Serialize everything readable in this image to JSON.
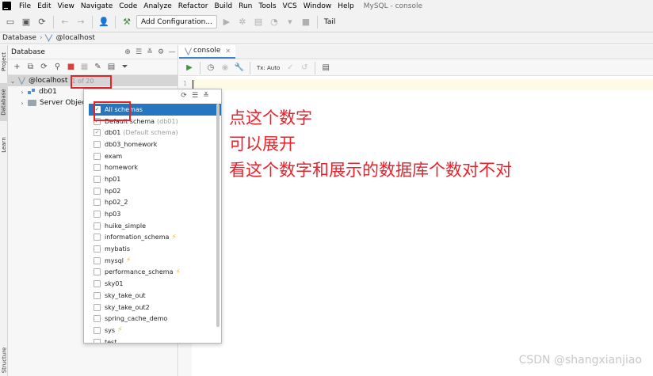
{
  "menu": {
    "items": [
      "File",
      "Edit",
      "View",
      "Navigate",
      "Code",
      "Analyze",
      "Refactor",
      "Build",
      "Run",
      "Tools",
      "VCS",
      "Window",
      "Help"
    ],
    "window_title": "MySQL - console"
  },
  "toolbar": {
    "add_config_label": "Add Configuration...",
    "tail_label": "Tail"
  },
  "breadcrumb": {
    "root": "Database",
    "host": "@localhost"
  },
  "left_stripe": {
    "project": "Project",
    "database": "Database",
    "learn": "Learn",
    "structure": "Structure"
  },
  "db_panel": {
    "title": "Database",
    "host": "@localhost",
    "count": "1 of 20",
    "db": "db01",
    "server_objects": "Server Objects"
  },
  "popup": {
    "items": [
      {
        "label": "All schemas",
        "hint": "",
        "checked": true,
        "selected": true,
        "bolt": false
      },
      {
        "label": "Default schema",
        "hint": "(db01)",
        "checked": true,
        "selected": false,
        "bolt": false
      },
      {
        "label": "db01",
        "hint": "(Default schema)",
        "checked": true,
        "selected": false,
        "bolt": false
      },
      {
        "label": "db03_homework",
        "hint": "",
        "checked": false,
        "selected": false,
        "bolt": false
      },
      {
        "label": "exam",
        "hint": "",
        "checked": false,
        "selected": false,
        "bolt": false
      },
      {
        "label": "homework",
        "hint": "",
        "checked": false,
        "selected": false,
        "bolt": false
      },
      {
        "label": "hp01",
        "hint": "",
        "checked": false,
        "selected": false,
        "bolt": false
      },
      {
        "label": "hp02",
        "hint": "",
        "checked": false,
        "selected": false,
        "bolt": false
      },
      {
        "label": "hp02_2",
        "hint": "",
        "checked": false,
        "selected": false,
        "bolt": false
      },
      {
        "label": "hp03",
        "hint": "",
        "checked": false,
        "selected": false,
        "bolt": false
      },
      {
        "label": "huike_simple",
        "hint": "",
        "checked": false,
        "selected": false,
        "bolt": false
      },
      {
        "label": "information_schema",
        "hint": "",
        "checked": false,
        "selected": false,
        "bolt": true
      },
      {
        "label": "mybatis",
        "hint": "",
        "checked": false,
        "selected": false,
        "bolt": false
      },
      {
        "label": "mysql",
        "hint": "",
        "checked": false,
        "selected": false,
        "bolt": true
      },
      {
        "label": "performance_schema",
        "hint": "",
        "checked": false,
        "selected": false,
        "bolt": true
      },
      {
        "label": "sky01",
        "hint": "",
        "checked": false,
        "selected": false,
        "bolt": false
      },
      {
        "label": "sky_take_out",
        "hint": "",
        "checked": false,
        "selected": false,
        "bolt": false
      },
      {
        "label": "sky_take_out2",
        "hint": "",
        "checked": false,
        "selected": false,
        "bolt": false
      },
      {
        "label": "spring_cache_demo",
        "hint": "",
        "checked": false,
        "selected": false,
        "bolt": false
      },
      {
        "label": "sys",
        "hint": "",
        "checked": false,
        "selected": false,
        "bolt": true
      },
      {
        "label": "test",
        "hint": "",
        "checked": false,
        "selected": false,
        "bolt": false
      }
    ]
  },
  "editor": {
    "tab_label": "console",
    "tx_label": "Tx: Auto",
    "line_number": "1"
  },
  "annotations": {
    "line1": "点这个数字",
    "line2": "可以展开",
    "line3": "看这个数字和展示的数据库个数对不对"
  },
  "watermark": "CSDN @shangxianjiao",
  "colors": {
    "annotation_red": "#e8222b",
    "selection_blue": "#2675bf",
    "bolt_yellow": "#f2b51d"
  }
}
